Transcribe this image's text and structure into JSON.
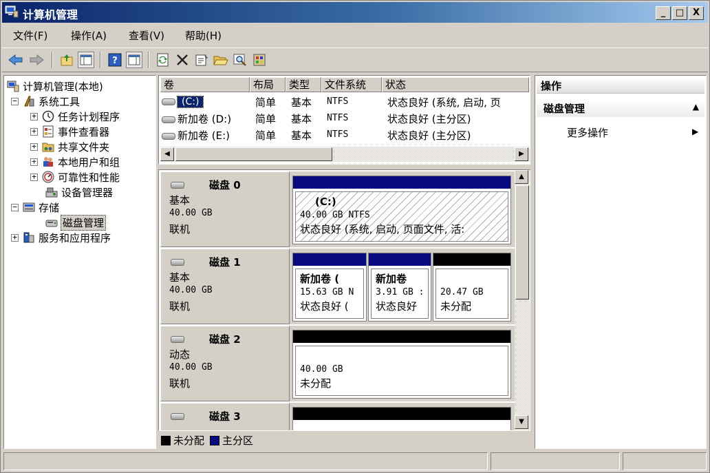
{
  "window": {
    "title": "计算机管理",
    "buttons": [
      "_",
      "□",
      "X"
    ]
  },
  "menu": [
    "文件(F)",
    "操作(A)",
    "查看(V)",
    "帮助(H)"
  ],
  "toolbar": {
    "icons": [
      "back-arrow-icon",
      "forward-arrow-icon",
      "up-folder-icon",
      "show-hide-tree-icon",
      "help-icon",
      "show-hide-action-pane-icon",
      "refresh-icon",
      "delete-icon",
      "properties-icon",
      "open-folder-icon",
      "search-icon",
      "disk-tools-icon"
    ]
  },
  "tree": {
    "items": [
      {
        "label": "计算机管理(本地)",
        "expander": "",
        "icon": "computer-management-icon"
      },
      {
        "label": "系统工具",
        "expander": "−",
        "icon": "system-tools-icon"
      },
      {
        "label": "任务计划程序",
        "expander": "+",
        "icon": "clock-icon"
      },
      {
        "label": "事件查看器",
        "expander": "+",
        "icon": "event-viewer-icon"
      },
      {
        "label": "共享文件夹",
        "expander": "+",
        "icon": "shared-folder-icon"
      },
      {
        "label": "本地用户和组",
        "expander": "+",
        "icon": "users-icon"
      },
      {
        "label": "可靠性和性能",
        "expander": "+",
        "icon": "performance-icon"
      },
      {
        "label": "设备管理器",
        "expander": "",
        "icon": "device-manager-icon"
      },
      {
        "label": "存储",
        "expander": "−",
        "icon": "storage-icon"
      },
      {
        "label": "磁盘管理",
        "expander": "",
        "icon": "disk-management-icon"
      },
      {
        "label": "服务和应用程序",
        "expander": "+",
        "icon": "services-icon"
      }
    ]
  },
  "volumes": {
    "headers": [
      "卷",
      "布局",
      "类型",
      "文件系统",
      "状态"
    ],
    "rows": [
      {
        "name": "(C:)",
        "layout": "简单",
        "type": "基本",
        "fs": "NTFS",
        "status": "状态良好 (系统, 启动, 页"
      },
      {
        "name": "新加卷 (D:)",
        "layout": "简单",
        "type": "基本",
        "fs": "NTFS",
        "status": "状态良好 (主分区)"
      },
      {
        "name": "新加卷 (E:)",
        "layout": "简单",
        "type": "基本",
        "fs": "NTFS",
        "status": "状态良好 (主分区)"
      }
    ]
  },
  "disks": [
    {
      "name": "磁盘 0",
      "kind": "基本",
      "size": "40.00 GB",
      "state": "联机",
      "partitions": [
        {
          "title": "(C:)",
          "line1": "40.00 GB NTFS",
          "line2": "状态良好 (系统, 启动, 页面文件, 活:",
          "bar": "#0a0a80",
          "hatched": true
        }
      ]
    },
    {
      "name": "磁盘 1",
      "kind": "基本",
      "size": "40.00 GB",
      "state": "联机",
      "partitions": [
        {
          "title": "新加卷 (",
          "line1": "15.63 GB N",
          "line2": "状态良好 (",
          "bar": "#0a0a80",
          "hatched": false
        },
        {
          "title": "新加卷",
          "line1": "3.91 GB :",
          "line2": "状态良好",
          "bar": "#0a0a80",
          "hatched": false
        },
        {
          "title": "",
          "line1": "20.47 GB",
          "line2": "未分配",
          "bar": "#000000",
          "hatched": false
        }
      ]
    },
    {
      "name": "磁盘 2",
      "kind": "动态",
      "size": "40.00 GB",
      "state": "联机",
      "partitions": [
        {
          "title": "",
          "line1": "40.00 GB",
          "line2": "未分配",
          "bar": "#000000",
          "hatched": false
        }
      ]
    },
    {
      "name": "磁盘 3",
      "kind": "",
      "size": "",
      "state": "",
      "partitions": [
        {
          "title": "",
          "line1": "",
          "line2": "",
          "bar": "#000000",
          "hatched": false
        }
      ]
    }
  ],
  "legend": [
    {
      "label": "未分配",
      "color": "#000000"
    },
    {
      "label": "主分区",
      "color": "#0a0a80"
    }
  ],
  "actions": {
    "header": "操作",
    "section": "磁盘管理",
    "item": "更多操作"
  }
}
